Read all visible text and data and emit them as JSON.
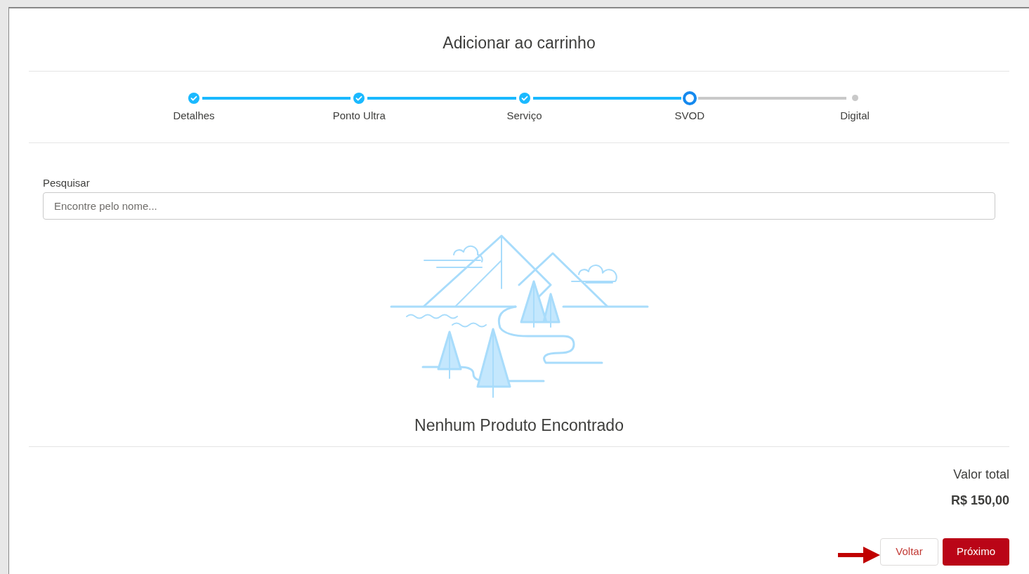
{
  "modal": {
    "title": "Adicionar ao carrinho"
  },
  "steps": [
    {
      "label": "Detalhes",
      "completed": true,
      "selected": false
    },
    {
      "label": "Ponto Ultra",
      "completed": true,
      "selected": false
    },
    {
      "label": "Serviço",
      "completed": true,
      "selected": false
    },
    {
      "label": "SVOD",
      "completed": false,
      "selected": true
    },
    {
      "label": "Digital",
      "completed": false,
      "selected": false
    }
  ],
  "search": {
    "label": "Pesquisar",
    "placeholder": "Encontre pelo nome..."
  },
  "empty_state": {
    "message": "Nenhum Produto Encontrado"
  },
  "total": {
    "label": "Valor total",
    "value": "R$ 150,00"
  },
  "buttons": [
    {
      "label": "Voltar",
      "kind": "secondary"
    },
    {
      "label": "Próximo",
      "kind": "primary"
    }
  ]
}
